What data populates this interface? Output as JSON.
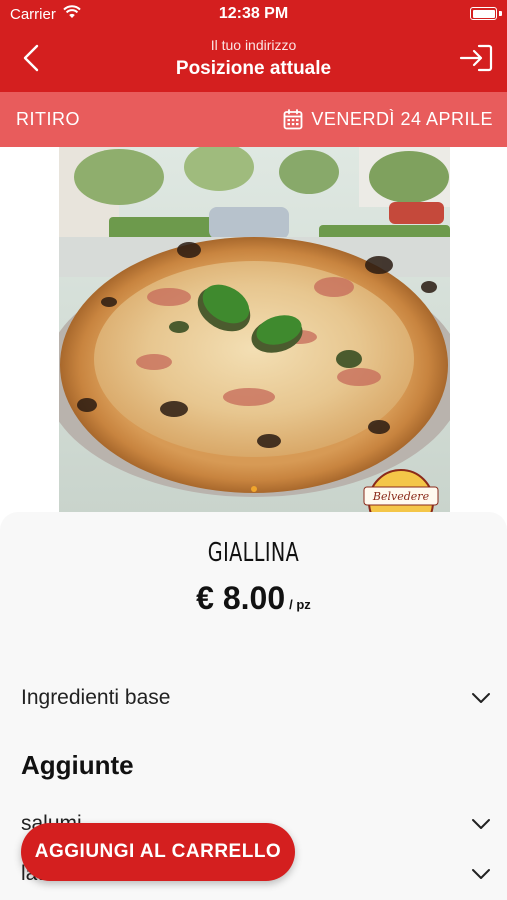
{
  "status_bar": {
    "carrier": "Carrier",
    "time": "12:38 PM"
  },
  "header": {
    "subtitle": "Il tuo indirizzo",
    "title": "Posizione attuale",
    "back_icon": "chevron-left-icon",
    "login_icon": "sign-in-icon"
  },
  "order_bar": {
    "mode": "RITIRO",
    "date": "VENERDÌ 24 APRILE",
    "date_icon": "calendar-icon"
  },
  "product": {
    "name": "GIALLINA",
    "price": "€ 8.00",
    "unit": "/ pz",
    "image_badge_text": "Belvedere"
  },
  "sections": {
    "base_ingredients": "Ingredienti base",
    "additions_title": "Aggiunte",
    "groups": [
      "salumi",
      "latticini"
    ]
  },
  "actions": {
    "add_to_cart": "AGGIUNGI AL CARRELLO"
  },
  "colors": {
    "primary": "#d41f1f",
    "secondary": "#e85c5c",
    "sheet": "#f8f8f8"
  }
}
